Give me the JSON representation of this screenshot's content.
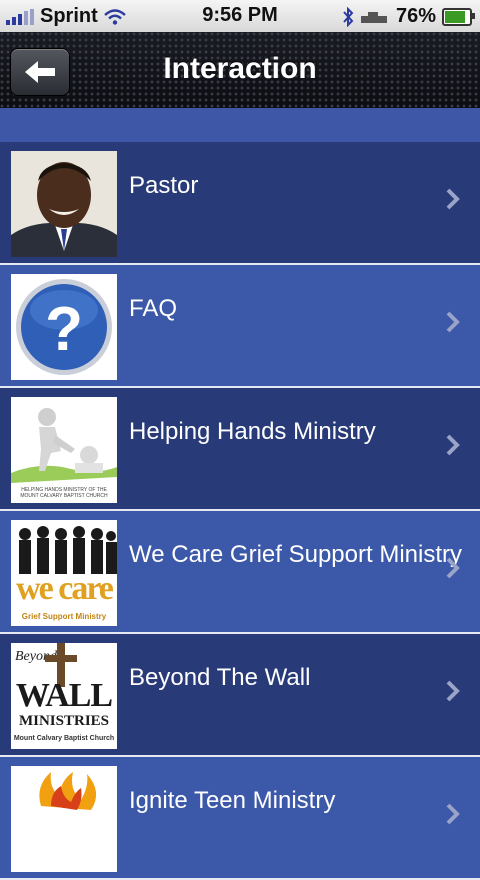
{
  "status_bar": {
    "carrier": "Sprint",
    "time": "9:56 PM",
    "battery": "76%"
  },
  "nav": {
    "title": "Interaction"
  },
  "items": [
    {
      "label": "Pastor"
    },
    {
      "label": "FAQ"
    },
    {
      "label": "Helping Hands Ministry"
    },
    {
      "label": "We Care Grief Support Ministry"
    },
    {
      "label": "Beyond The Wall"
    },
    {
      "label": "Ignite Teen Ministry"
    }
  ],
  "thumbnail_text": {
    "we_care_main": "we care",
    "we_care_sub": "Grief Support Ministry",
    "wall_top": "Beyond",
    "wall_main": "WALL",
    "wall_ministries": "MINISTRIES",
    "wall_church": "Mount Calvary Baptist Church",
    "helping_caption": "HELPING HANDS MINISTRY OF THE MOUNT CALVARY BAPTIST CHURCH"
  },
  "colors": {
    "row_dark": "#293a78",
    "row_light": "#3c58a8",
    "nav_bar": "#14161d"
  }
}
